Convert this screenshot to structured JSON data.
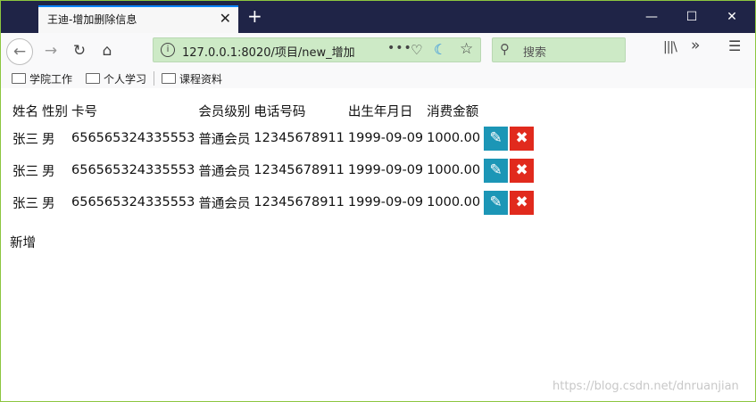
{
  "tab": {
    "title": "王迪-增加删除信息",
    "close": "✕"
  },
  "window": {
    "new_tab": "+",
    "minimize": "—",
    "maximize": "☐",
    "close": "✕"
  },
  "nav": {
    "url": "127.0.0.1:8020/项目/new_增加",
    "url_more": "•••",
    "search_placeholder": "搜索"
  },
  "bookmarks": [
    "学院工作",
    "个人学习",
    "课程资料"
  ],
  "table": {
    "headers": [
      "姓名",
      "性别",
      "卡号",
      "会员级别",
      "电话号码",
      "出生年月日",
      "消费金额"
    ],
    "rows": [
      {
        "name": "张三",
        "gender": "男",
        "card": "656565324335553",
        "level": "普通会员",
        "phone": "12345678911",
        "birth": "1999-09-09",
        "amount": "1000.00"
      },
      {
        "name": "张三",
        "gender": "男",
        "card": "656565324335553",
        "level": "普通会员",
        "phone": "12345678911",
        "birth": "1999-09-09",
        "amount": "1000.00"
      },
      {
        "name": "张三",
        "gender": "男",
        "card": "656565324335553",
        "level": "普通会员",
        "phone": "12345678911",
        "birth": "1999-09-09",
        "amount": "1000.00"
      }
    ],
    "edit_icon": "✎",
    "delete_icon": "✖"
  },
  "add_label": "新增",
  "watermark": "https://blog.csdn.net/dnruanjian"
}
